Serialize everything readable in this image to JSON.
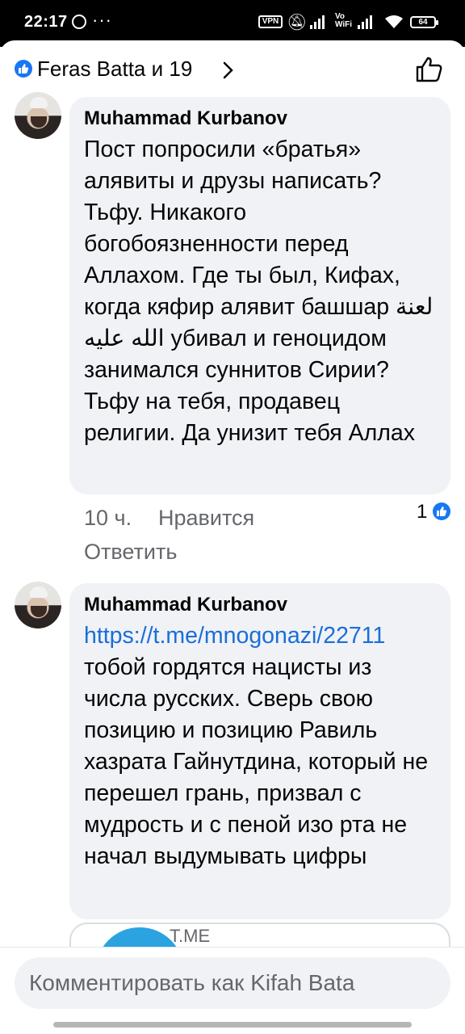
{
  "status_bar": {
    "time": "22:17",
    "vpn": "VPN",
    "vowifi": "Vo\nWiFi",
    "battery": "64"
  },
  "header": {
    "reactions_label": "Feras Batta и 19"
  },
  "comments": [
    {
      "author": "Muhammad Kurbanov",
      "text": "Пост попросили «братья» алявиты и друзы написать? Тьфу. Никакого богобоязненности перед Аллахом. Где ты был, Кифах, когда кяфир алявит башшар لعنة الله عليه убивал и геноцидом занимался суннитов Сирии? Тьфу на тебя, продавец религии. Да унизит тебя Аллах",
      "time": "10 ч.",
      "like_action": "Нравится",
      "reply_action": "Ответить",
      "like_count": "1"
    },
    {
      "author": "Muhammad Kurbanov",
      "link": "https://t.me/mnogonazi/22711",
      "text": "тобой гордятся нацисты из числа русских. Сверь свою позицию и позицию Равиль хазрата Гайнутдина, который не перешел грань, призвал с мудрость и с пеной изо рта не начал выдумывать цифры",
      "preview_domain": "T.ME"
    }
  ],
  "composer": {
    "placeholder": "Комментировать как Kifah Bata"
  },
  "colors": {
    "facebook_blue": "#1877f2",
    "link": "#1a6ed8",
    "bubble": "#f0f2f5",
    "secondary_text": "#65676b"
  }
}
